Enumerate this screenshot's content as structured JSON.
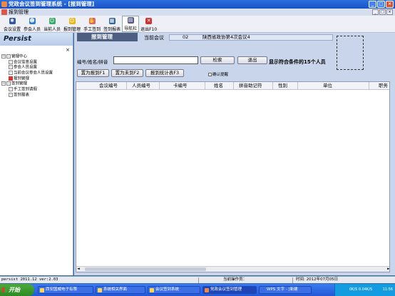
{
  "window": {
    "title": "党政会议签到管理系统 - [报到管理]",
    "subtitle": "报到管理",
    "buttons": [
      "_",
      "□",
      "×"
    ],
    "sub_buttons": [
      "_",
      "□",
      "×"
    ]
  },
  "toolbar": {
    "items": [
      {
        "label": "会议设置",
        "icon": "gear-icon",
        "color": "#3355aa"
      },
      {
        "label": "参会人员",
        "icon": "people-icon",
        "color": "#2e7bd4"
      },
      {
        "label": "当前人员",
        "icon": "person-icon",
        "color": "#3a6"
      },
      {
        "label": "报到管理",
        "icon": "smiley-icon",
        "color": "#e7b81a"
      },
      {
        "label": "手工签到",
        "icon": "hand-icon",
        "color": "#d66"
      },
      {
        "label": "签到报表",
        "icon": "table-icon",
        "color": "#369"
      },
      {
        "label": "导航栏",
        "icon": "nav-icon",
        "color": "#558"
      },
      {
        "label": "退出F10",
        "icon": "exit-icon",
        "color": "#c33"
      }
    ]
  },
  "left_panel": {
    "title": "Persist",
    "close": "×",
    "tree": [
      {
        "label": "管理中心",
        "level": 0,
        "type": "group"
      },
      {
        "label": "会议信息设置",
        "level": 1,
        "type": "item"
      },
      {
        "label": "参会人员设置",
        "level": 1,
        "type": "item"
      },
      {
        "label": "当前会议参会人员设置",
        "level": 1,
        "type": "item"
      },
      {
        "label": "报到管理",
        "level": 1,
        "type": "selected"
      },
      {
        "label": "签到管理",
        "level": 0,
        "type": "group"
      },
      {
        "label": "手工签到请假",
        "level": 1,
        "type": "item"
      },
      {
        "label": "签到报表",
        "level": 1,
        "type": "item"
      }
    ]
  },
  "main": {
    "tab_label": "报到管理",
    "current_meeting_label": "当前会议",
    "meeting_no": "02",
    "meeting_title": "陕西省政协第4次会议4",
    "search_label": "编号/姓名/拼音",
    "search_value": "",
    "search_button": "检索",
    "exit_button": "退出",
    "result_message": "显示符合条件的15个人员",
    "btn_mark_reported": "置为报到F1",
    "btn_mark_unreported": "置为未到F2",
    "btn_report_stats": "报到统计表F3",
    "confirm_prompt": "确认提醒"
  },
  "grid": {
    "columns": [
      "会议编号",
      "人员编号",
      "卡编号",
      "姓名",
      "拼音助记符",
      "性别",
      "单位",
      "职务"
    ],
    "rows": []
  },
  "statusbar": {
    "version": "persist 2011.12 ver:2.03",
    "operator": "当前操作员：",
    "time": "时间: 2012年07月05日"
  },
  "taskbar": {
    "start": "开始",
    "tasks": [
      "西安国威电子有限",
      "系统相关界面",
      "会议签到系统",
      "党政会议签到管理",
      "WPS 文字 - [新建"
    ],
    "tray": "0K/S   0.04K/S",
    "clock": "11:56"
  }
}
